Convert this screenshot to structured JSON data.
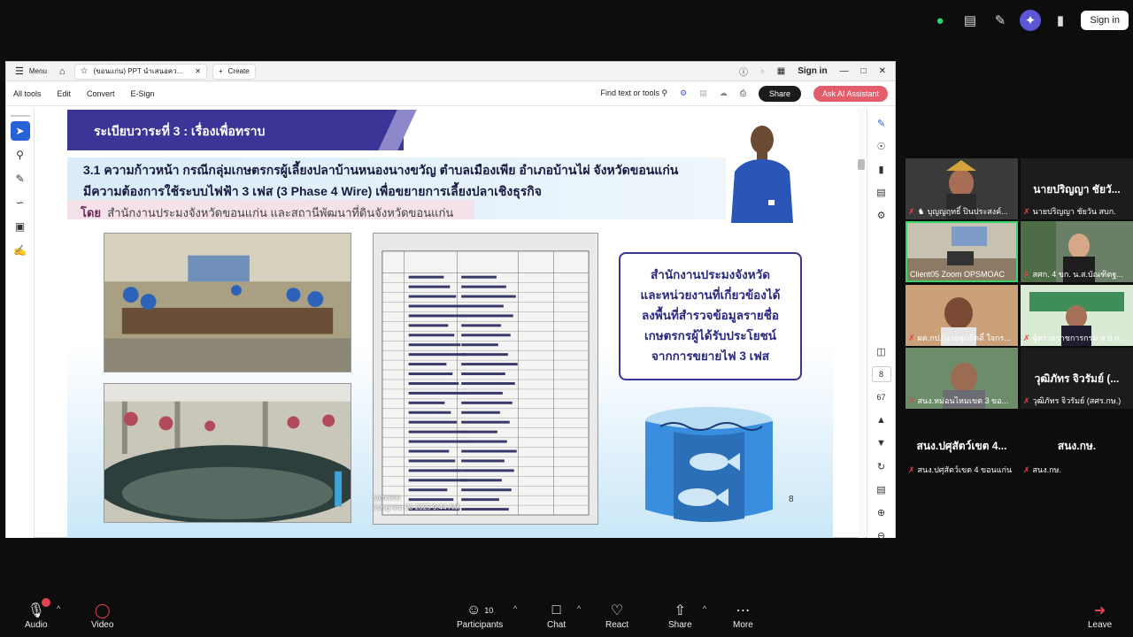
{
  "zoom_top": {
    "signin_label": "Sign in"
  },
  "acrobat": {
    "menu_label": "Menu",
    "tab_title": "(ขอนแก่น) PPT นำเสนอคว...",
    "create_label": "Create",
    "signin_label": "Sign in",
    "tools": {
      "all_tools": "All tools",
      "edit": "Edit",
      "convert": "Convert",
      "esign": "E-Sign",
      "find": "Find text or tools",
      "share": "Share",
      "ai": "Ask AI Assistant"
    },
    "page_current": "8",
    "page_total": "67"
  },
  "slide": {
    "title": "ระเบียบวาระที่ 3 : เรื่องเพื่อทราบ",
    "line1": "3.1 ความก้าวหน้า กรณีกลุ่มเกษตรกรผู้เลี้ยงปลาบ้านหนองนางขวัญ ตำบลเมืองเพีย อำเภอบ้านไผ่ จังหวัดขอนแก่น",
    "line2": "มีความต้องการใช้ระบบไฟฟ้า 3 เฟส (3 Phase 4 Wire) เพื่อขยายการเลี้ยงปลาเชิงธุรกิจ",
    "by_label": "โดย",
    "by_text": "สำนักงานประมงจังหวัดขอนแก่น และสถานีพัฒนาที่ดินจังหวัดขอนแก่น",
    "box_lines": [
      "สำนักงานประมงจังหวัด",
      "และหน่วยงานที่เกี่ยวข้องได้",
      "ลงพื้นที่สำรวจข้อมูลรายชื่อ",
      "เกษตรกรผู้ได้รับประโยชน์",
      "จากการขยายไฟ 3 เฟส"
    ],
    "doc_caption_1": "samreon",
    "doc_caption_2": "กรกฎาคม 20 2025 9:44 AM",
    "page_number": "8"
  },
  "participants": [
    {
      "label": "บุญญฤทธิ์ ปินประสงค์...",
      "big_name": ""
    },
    {
      "label": "นายปริญญา ชัยวัน สบก.",
      "big_name": "นายปริญญา ชัยวั..."
    },
    {
      "label": "Client05 Zoom OPSMOAC",
      "big_name": ""
    },
    {
      "label": "สศก. 4 ขก. น.ส.บัณฑิตฐ...",
      "big_name": ""
    },
    {
      "label": "ผต.กป.(นายสุภกิตติ์ ใจกร...",
      "big_name": ""
    },
    {
      "label": "ผู้ตรวจราชการกรม ส.ป.ก...",
      "big_name": ""
    },
    {
      "label": "สนง.หม่อนไหมเขต 3 ขอ...",
      "big_name": ""
    },
    {
      "label": "วุฒิภัทร จิวรัมย์ (สศร.กษ.)",
      "big_name": "วุฒิภัทร จิวรัมย์ (..."
    },
    {
      "label": "สนง.ปศุสัตว์เขต 4 ขอนแก่น",
      "big_name": "สนง.ปศุสัตว์เขต 4..."
    },
    {
      "label": "สนง.กษ.",
      "big_name": "สนง.กษ."
    }
  ],
  "bottom": {
    "audio": "Audio",
    "video": "Video",
    "participants": "Participants",
    "participants_count": "10",
    "chat": "Chat",
    "react": "React",
    "share": "Share",
    "more": "More",
    "leave": "Leave"
  },
  "colors": {
    "slide_header": "#3a3596",
    "share_btn": "#1b1b1b",
    "ai_btn": "#e35d6a",
    "active_tile_border": "#3cd36b",
    "mic_off": "#e0444f"
  }
}
